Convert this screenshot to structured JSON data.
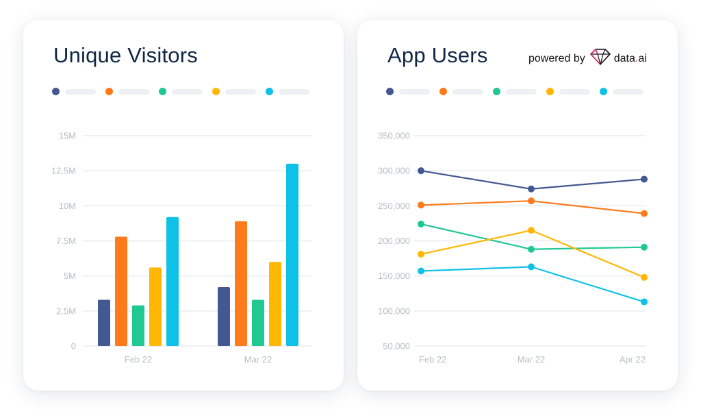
{
  "colors": {
    "series": [
      "#435891",
      "#ff7a1a",
      "#20c893",
      "#ffb703",
      "#0ec1e6"
    ],
    "title": "#0f2744",
    "grid": "#e9ecf0",
    "tick": "#b7bcc6",
    "legend_placeholder": "#eef0f3"
  },
  "left_card": {
    "title": "Unique Visitors"
  },
  "right_card": {
    "title": "App Users",
    "powered_by": "powered by",
    "brand_name_a": "data",
    "brand_name_dot": ".",
    "brand_name_b": "ai"
  },
  "chart_data": [
    {
      "type": "bar",
      "title": "Unique Visitors",
      "categories": [
        "Feb 22",
        "Mar 22"
      ],
      "series": [
        {
          "name": "",
          "color": "#435891",
          "values": [
            3.3,
            4.2
          ]
        },
        {
          "name": "",
          "color": "#ff7a1a",
          "values": [
            7.8,
            8.9
          ]
        },
        {
          "name": "",
          "color": "#20c893",
          "values": [
            2.9,
            3.3
          ]
        },
        {
          "name": "",
          "color": "#ffb703",
          "values": [
            5.6,
            6.0
          ]
        },
        {
          "name": "",
          "color": "#0ec1e6",
          "values": [
            9.2,
            13.0
          ]
        }
      ],
      "units": "M",
      "ylim": [
        0,
        15
      ],
      "yticks": [
        0,
        2.5,
        5,
        7.5,
        10,
        12.5,
        15
      ],
      "ytick_labels": [
        "0",
        "2.5M",
        "5M",
        "7.5M",
        "10M",
        "12.5M",
        "15M"
      ],
      "xlabel": "",
      "ylabel": "",
      "grid": true,
      "legend": "top (labels hidden)"
    },
    {
      "type": "line",
      "title": "App Users",
      "categories": [
        "Feb 22",
        "Mar 22",
        "Apr 22"
      ],
      "series": [
        {
          "name": "",
          "color": "#435891",
          "values": [
            300000,
            274000,
            288000
          ]
        },
        {
          "name": "",
          "color": "#ff7a1a",
          "values": [
            251000,
            257000,
            239000
          ]
        },
        {
          "name": "",
          "color": "#20c893",
          "values": [
            224000,
            188000,
            191000
          ]
        },
        {
          "name": "",
          "color": "#ffb703",
          "values": [
            181000,
            215000,
            148000
          ]
        },
        {
          "name": "",
          "color": "#0ec1e6",
          "values": [
            157000,
            163000,
            113000
          ]
        }
      ],
      "ylim": [
        50000,
        350000
      ],
      "yticks": [
        50000,
        100000,
        150000,
        200000,
        250000,
        300000,
        350000
      ],
      "ytick_labels": [
        "50,000",
        "100,000",
        "150,000",
        "200,000",
        "250,000",
        "300,000",
        "350,000"
      ],
      "xlabel": "",
      "ylabel": "",
      "grid": true,
      "legend": "top (labels hidden)"
    }
  ]
}
